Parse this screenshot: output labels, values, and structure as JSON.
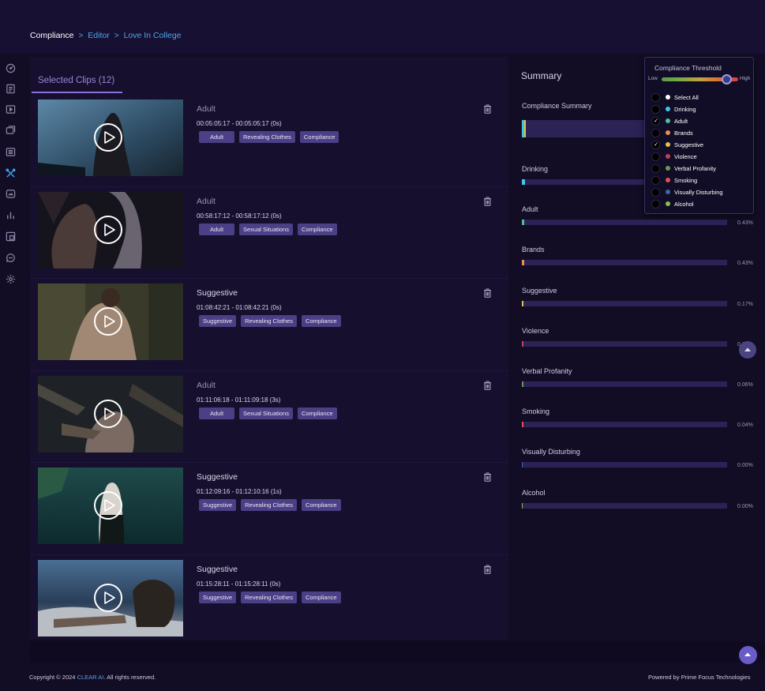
{
  "breadcrumb": {
    "items": [
      "Compliance",
      "Editor",
      "Love In College"
    ],
    "separator": ">"
  },
  "sidebar": {
    "icons": [
      {
        "name": "dashboard-icon",
        "active": false
      },
      {
        "name": "report-icon",
        "active": false
      },
      {
        "name": "video-icon",
        "active": false
      },
      {
        "name": "media-library-icon",
        "active": false
      },
      {
        "name": "catalog-icon",
        "active": false
      },
      {
        "name": "tools-icon",
        "active": true
      },
      {
        "name": "speed-icon",
        "active": false
      },
      {
        "name": "analytics-icon",
        "active": false
      },
      {
        "name": "frame-icon",
        "active": false
      },
      {
        "name": "chat-icon",
        "active": false
      },
      {
        "name": "settings-icon",
        "active": false
      }
    ]
  },
  "clips_tab": {
    "label": "Selected Clips (12)"
  },
  "clips": [
    {
      "title": "Adult",
      "time": "00:05:05:17 - 00:05:05:17 (0s)",
      "tags": [
        "Adult",
        "Revealing Clothes",
        "Compliance"
      ],
      "muted": true
    },
    {
      "title": "Adult",
      "time": "00:58:17:12 - 00:58:17:12 (0s)",
      "tags": [
        "Adult",
        "Sexual Situations",
        "Compliance"
      ],
      "muted": true
    },
    {
      "title": "Suggestive",
      "time": "01:08:42:21 - 01:08:42:21 (0s)",
      "tags": [
        "Suggestive",
        "Revealing Clothes",
        "Compliance"
      ],
      "muted": false
    },
    {
      "title": "Adult",
      "time": "01:11:06:18 - 01:11:09:18 (3s)",
      "tags": [
        "Adult",
        "Sexual Situations",
        "Compliance"
      ],
      "muted": true
    },
    {
      "title": "Suggestive",
      "time": "01:12:09:16 - 01:12:10:16 (1s)",
      "tags": [
        "Suggestive",
        "Revealing Clothes",
        "Compliance"
      ],
      "muted": false
    },
    {
      "title": "Suggestive",
      "time": "01:15:28:11 - 01:15:28:11 (0s)",
      "tags": [
        "Suggestive",
        "Revealing Clothes",
        "Compliance"
      ],
      "muted": false
    }
  ],
  "summary": {
    "title": "Summary",
    "compliance_summary_label": "Compliance Summary",
    "categories": [
      {
        "name": "Drinking",
        "pct": "",
        "value": 1.0,
        "color": "#3fc7e8"
      },
      {
        "name": "Adult",
        "pct": "0.43%",
        "value": 0.43,
        "color": "#4fbfa0"
      },
      {
        "name": "Brands",
        "pct": "0.43%",
        "value": 0.43,
        "color": "#e89050"
      },
      {
        "name": "Suggestive",
        "pct": "0.17%",
        "value": 0.17,
        "color": "#e0c050"
      },
      {
        "name": "Violence",
        "pct": "0.11%",
        "value": 0.11,
        "color": "#c04060"
      },
      {
        "name": "Verbal Profanity",
        "pct": "0.06%",
        "value": 0.06,
        "color": "#6a9a50"
      },
      {
        "name": "Smoking",
        "pct": "0.04%",
        "value": 0.04,
        "color": "#e05050"
      },
      {
        "name": "Visually Disturbing",
        "pct": "0.00%",
        "value": 0.0,
        "color": "#3a6aa8"
      },
      {
        "name": "Alcohol",
        "pct": "0.00%",
        "value": 0.0,
        "color": "#8ac050"
      }
    ]
  },
  "threshold": {
    "title": "Compliance Threshold",
    "low_label": "Low",
    "high_label": "High",
    "level": 0.85,
    "items": [
      {
        "name": "Select All",
        "color": "#ffffff",
        "checked": false
      },
      {
        "name": "Drinking",
        "color": "#3fc7e8",
        "checked": false
      },
      {
        "name": "Adult",
        "color": "#4fbfa0",
        "checked": true
      },
      {
        "name": "Brands",
        "color": "#e89050",
        "checked": false
      },
      {
        "name": "Suggestive",
        "color": "#e0c050",
        "checked": true
      },
      {
        "name": "Violence",
        "color": "#c04060",
        "checked": false
      },
      {
        "name": "Verbal Profanity",
        "color": "#6a9a50",
        "checked": false
      },
      {
        "name": "Smoking",
        "color": "#e05050",
        "checked": false
      },
      {
        "name": "Visually Disturbing",
        "color": "#3a6aa8",
        "checked": false
      },
      {
        "name": "Alcohol",
        "color": "#8ac050",
        "checked": false
      }
    ]
  },
  "footer": {
    "copyright_prefix": "Copyright © 2024",
    "brand": "CLEAR AI",
    "copyright_suffix": ". All rights reserved.",
    "powered_by": "Powered by Prime Focus Technologies"
  }
}
